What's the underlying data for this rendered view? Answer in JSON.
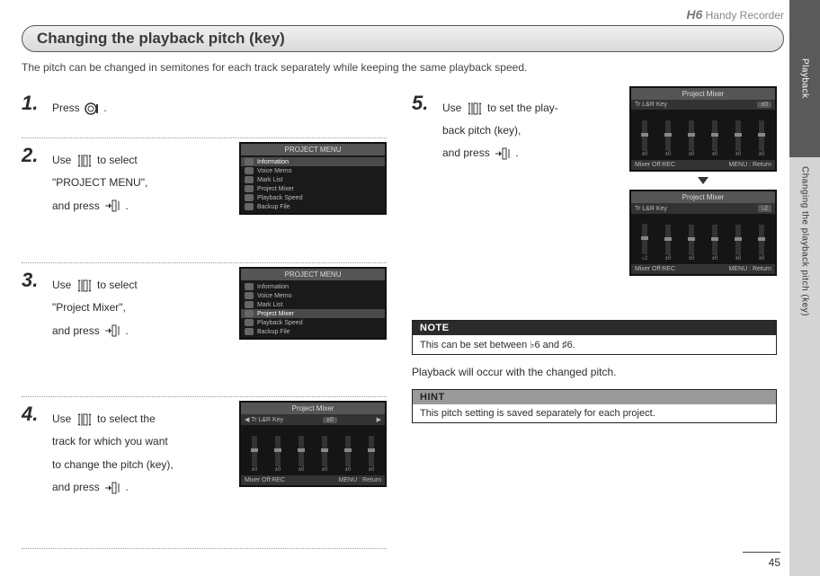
{
  "header": {
    "model": "H6",
    "product": "Handy Recorder"
  },
  "side": {
    "section": "Playback",
    "subsection": "Changing the playback pitch (key)"
  },
  "title": "Changing the playback pitch (key)",
  "intro": "The pitch can be changed in semitones for each track separately while keeping the same playback speed.",
  "steps": {
    "s1": {
      "num": "1.",
      "text_a": "Press ",
      "text_b": "."
    },
    "s2": {
      "num": "2.",
      "a": "Use ",
      "b": " to select",
      "c": "\"PROJECT MENU\",",
      "d": "and press ",
      "e": "."
    },
    "s3": {
      "num": "3.",
      "a": "Use ",
      "b": " to select",
      "c": "\"Project Mixer\",",
      "d": "and press ",
      "e": "."
    },
    "s4": {
      "num": "4.",
      "a": "Use ",
      "b": " to select the",
      "c": "track for which you want",
      "d": "to change the pitch (key),",
      "e": "and press ",
      "f": "."
    },
    "s5": {
      "num": "5.",
      "a": "Use ",
      "b": " to set the play-",
      "c": "back pitch (key),",
      "d": "and press ",
      "e": "."
    }
  },
  "lcd_menu": {
    "title": "PROJECT MENU",
    "items": [
      "Information",
      "Voice Memo",
      "Mark List",
      "Project Mixer",
      "Playback Speed",
      "Backup File"
    ],
    "sel_step2": 0,
    "sel_step3": 3
  },
  "lcd_mixer": {
    "title": "Project Mixer",
    "top_left": "Tr L&R Key",
    "top_right_a": "±0",
    "top_right_b": "♭2",
    "bottom_left": "Mixer Off:REC",
    "bottom_right": "MENU : Return",
    "fader_labels": [
      "±0",
      "±0",
      "±0",
      "±0",
      "±0",
      "±0"
    ],
    "fader_labels_b": [
      "♭2",
      "±0",
      "±0",
      "±0",
      "±0",
      "±0"
    ]
  },
  "note": {
    "hd": "NOTE",
    "bd": "This can be set between ♭6 and ♯6."
  },
  "after_note": "Playback will occur with the changed pitch.",
  "hint": {
    "hd": "HINT",
    "bd": "This pitch setting is saved separately for each project."
  },
  "page_number": "45"
}
